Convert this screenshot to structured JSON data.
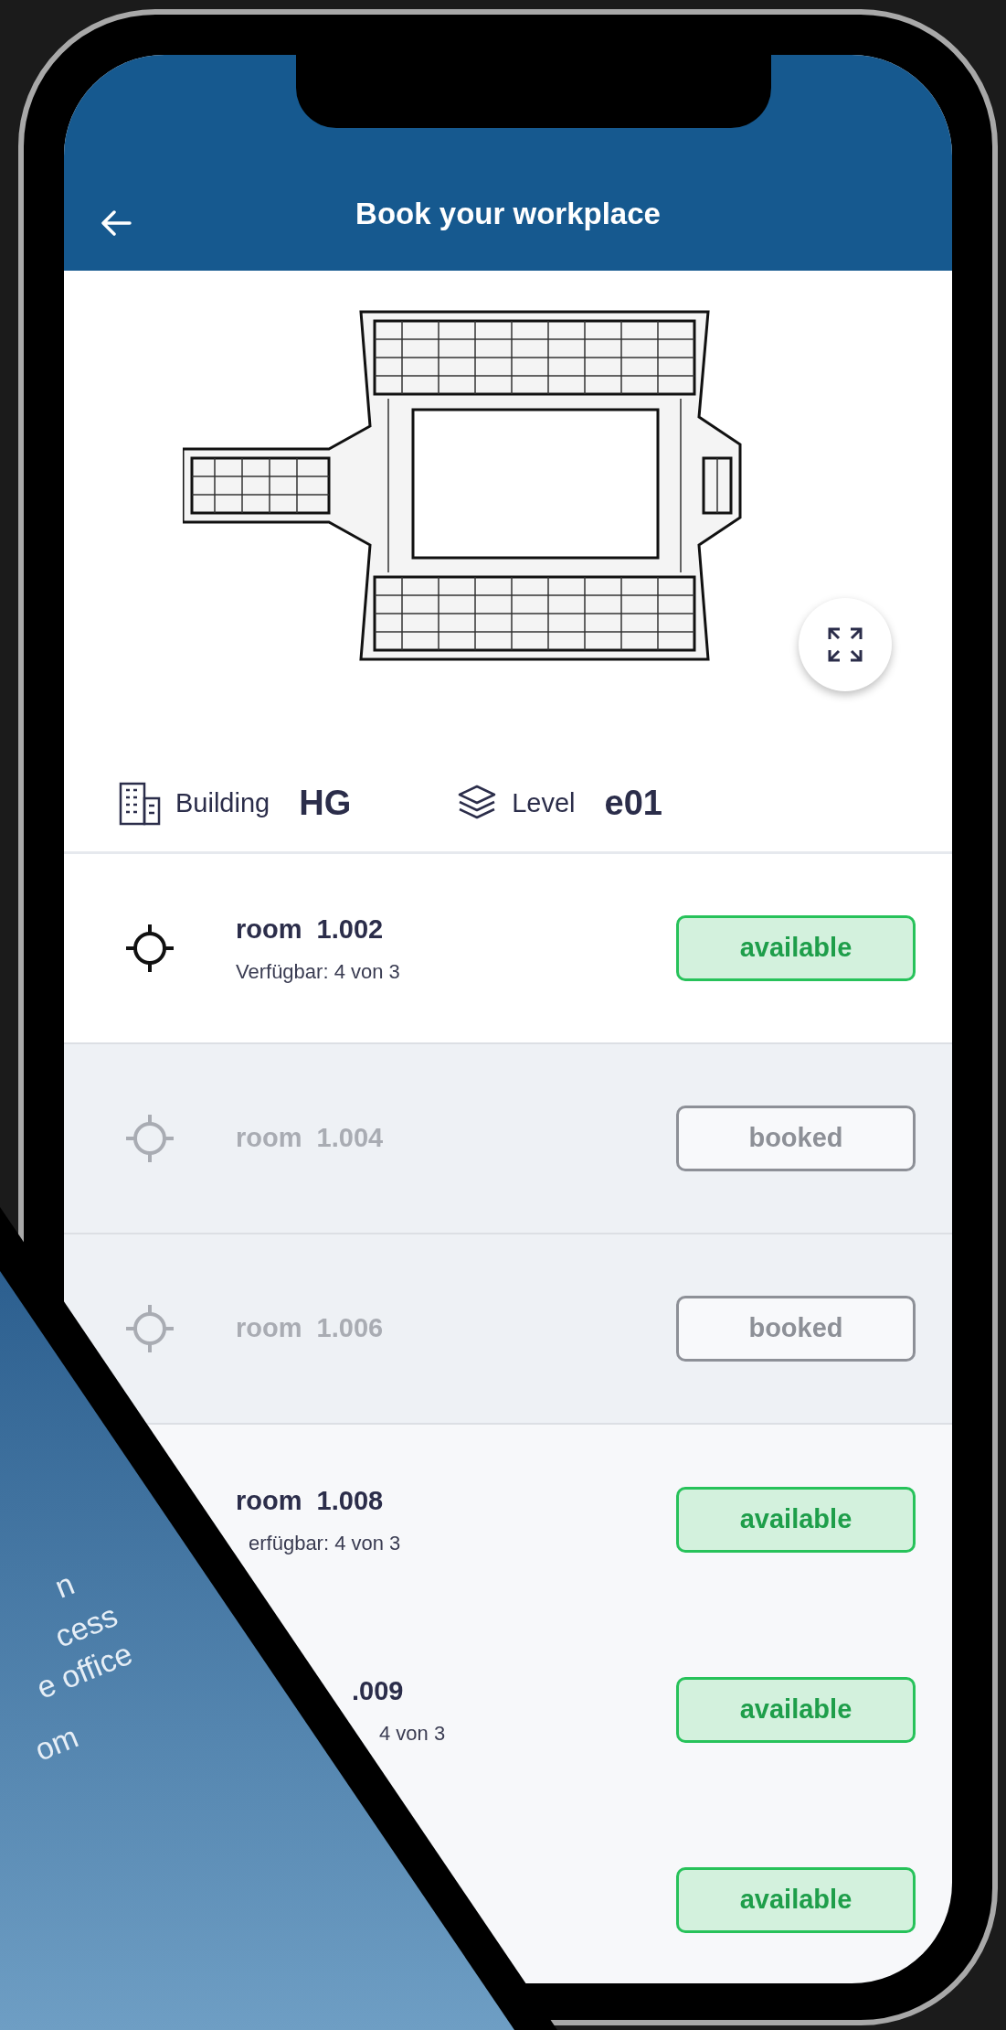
{
  "header": {
    "title": "Book your workplace"
  },
  "location": {
    "building_label": "Building",
    "building": "HG",
    "level_label": "Level",
    "level": "e01"
  },
  "rooms": [
    {
      "name": "room  1.002",
      "availability": "Verfügbar: 4 von 3",
      "status": "available"
    },
    {
      "name": "room  1.004",
      "status": "booked"
    },
    {
      "name": "room  1.006",
      "status": "booked"
    },
    {
      "name": "room  1.008",
      "availability": "erfügbar: 4 von 3",
      "status": "available"
    },
    {
      "name": ".009",
      "availability": "4 von 3",
      "status": "available"
    },
    {
      "status": "available"
    }
  ],
  "overlay_text": [
    "n",
    "cess",
    "e office",
    "om"
  ]
}
